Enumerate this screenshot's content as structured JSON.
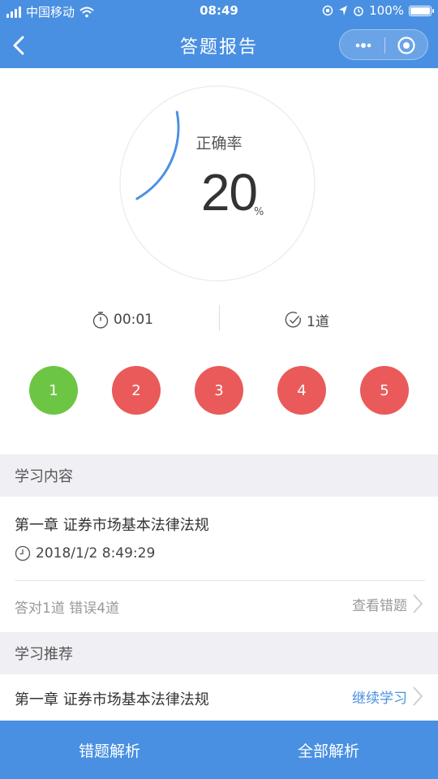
{
  "status_bar": {
    "carrier": "中国移动",
    "time": "08:49",
    "battery": "100%",
    "icons": [
      "signal-icon",
      "wifi-icon",
      "orientation-lock-icon",
      "location-icon",
      "alarm-icon",
      "battery-icon"
    ]
  },
  "nav": {
    "title": "答题报告",
    "back_icon": "chevron-left-icon",
    "capsule_icons": [
      "more-dots-icon",
      "close-target-icon"
    ]
  },
  "score": {
    "label": "正确率",
    "value": "20",
    "unit": "%",
    "progress_fraction": 0.2
  },
  "stats": {
    "time": "00:01",
    "count": "1道"
  },
  "questions": [
    {
      "number": "1",
      "status": "correct"
    },
    {
      "number": "2",
      "status": "wrong"
    },
    {
      "number": "3",
      "status": "wrong"
    },
    {
      "number": "4",
      "status": "wrong"
    },
    {
      "number": "5",
      "status": "wrong"
    }
  ],
  "study_content": {
    "header": "学习内容",
    "title": "第一章 证券市场基本法律法规",
    "datetime": "2018/1/2 8:49:29",
    "result": "答对1道 错误4道",
    "view_wrong": "查看错题"
  },
  "recommend": {
    "header": "学习推荐",
    "title": "第一章 证券市场基本法律法规",
    "continue": "继续学习"
  },
  "bottom_bar": {
    "wrong_analysis": "错题解析",
    "all_analysis": "全部解析"
  },
  "colors": {
    "primary": "#4a90e2",
    "correct": "#6cc644",
    "wrong": "#ea5a5a",
    "section_bg": "#efeff4"
  }
}
